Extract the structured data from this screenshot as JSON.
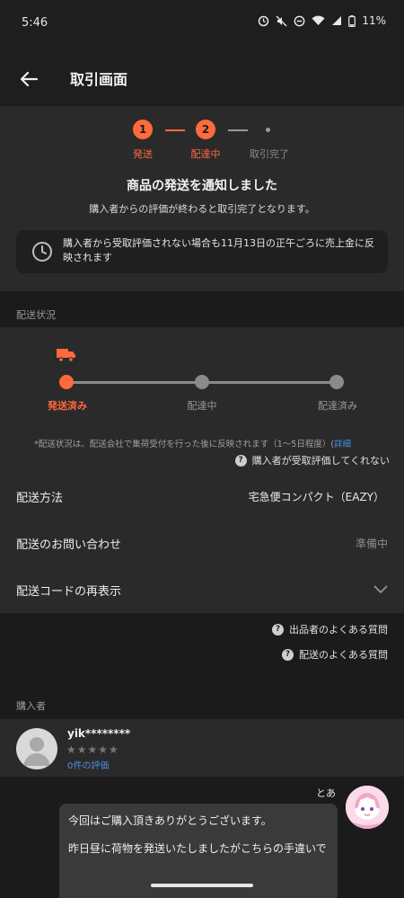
{
  "status_bar": {
    "time": "5:46",
    "battery": "11%"
  },
  "header": {
    "title": "取引画面"
  },
  "progress": {
    "steps": [
      {
        "number": "1",
        "label": "発送"
      },
      {
        "number": "2",
        "label": "配達中"
      },
      {
        "number": "",
        "label": "取引完了"
      }
    ]
  },
  "notice": {
    "title": "商品の発送を通知しました",
    "subtitle": "購入者からの評価が終わると取引完了となります。",
    "info": "購入者から受取評価されない場合も11月13日の正午ごろに売上金に反映されます"
  },
  "shipping": {
    "section_label": "配送状況",
    "tracking": [
      "発送済み",
      "配達中",
      "配達済み"
    ],
    "note_prefix": "*配送状況は、配送会社で集荷受付を行った後に反映されます（1〜5日程度）(",
    "note_link": "詳細",
    "help_link": "購入者が受取評価してくれない",
    "method_label": "配送方法",
    "method_value": "宅急便コンパクト（EAZY）",
    "inquiry_label": "配送のお問い合わせ",
    "inquiry_value": "準備中",
    "code_label": "配送コードの再表示"
  },
  "faq": {
    "seller": "出品者のよくある質問",
    "shipping": "配送のよくある質問"
  },
  "buyer": {
    "section_label": "購入者",
    "name": "yik********",
    "stars": "★★★★★",
    "rating_count": "0件の評価"
  },
  "chat": {
    "sender": "とあ",
    "line1": "今回はご購入頂きありがとうございます。",
    "line2": "昨日昼に荷物を発送いたしましたがこちらの手違いで"
  },
  "colors": {
    "accent": "#ff6a3d",
    "link": "#4a90e2"
  }
}
